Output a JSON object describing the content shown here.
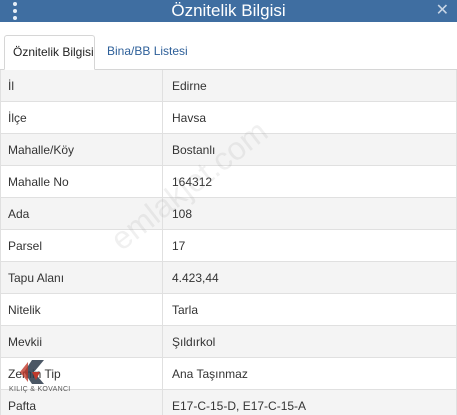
{
  "header": {
    "title": "Öznitelik Bilgisi",
    "menu_icon": "vertical-dots-icon",
    "close_icon": "close-icon",
    "close_glyph": "✕"
  },
  "tabs": [
    {
      "label": "Öznitelik Bilgisi",
      "active": true
    },
    {
      "label": "Bina/BB Listesi",
      "active": false
    }
  ],
  "table": {
    "rows": [
      {
        "key": "İl",
        "value": "Edirne"
      },
      {
        "key": "İlçe",
        "value": "Havsa"
      },
      {
        "key": "Mahalle/Köy",
        "value": "Bostanlı"
      },
      {
        "key": "Mahalle No",
        "value": "164312"
      },
      {
        "key": "Ada",
        "value": "108"
      },
      {
        "key": "Parsel",
        "value": "17"
      },
      {
        "key": "Tapu Alanı",
        "value": "4.423,44"
      },
      {
        "key": "Nitelik",
        "value": "Tarla"
      },
      {
        "key": "Mevkii",
        "value": "Şıldırkol"
      },
      {
        "key": "Zemin Tip",
        "value": "Ana Taşınmaz"
      },
      {
        "key": "Pafta",
        "value": "E17-C-15-D, E17-C-15-A"
      }
    ]
  },
  "watermark": {
    "text": "emlakjet.com"
  },
  "logo": {
    "text": "KILIÇ & KOVANCI",
    "colors": {
      "dark": "#2b3a4a",
      "red": "#c0392b"
    }
  },
  "colors": {
    "header_bg": "#3f6ea1",
    "tab_link": "#2d5f99"
  }
}
